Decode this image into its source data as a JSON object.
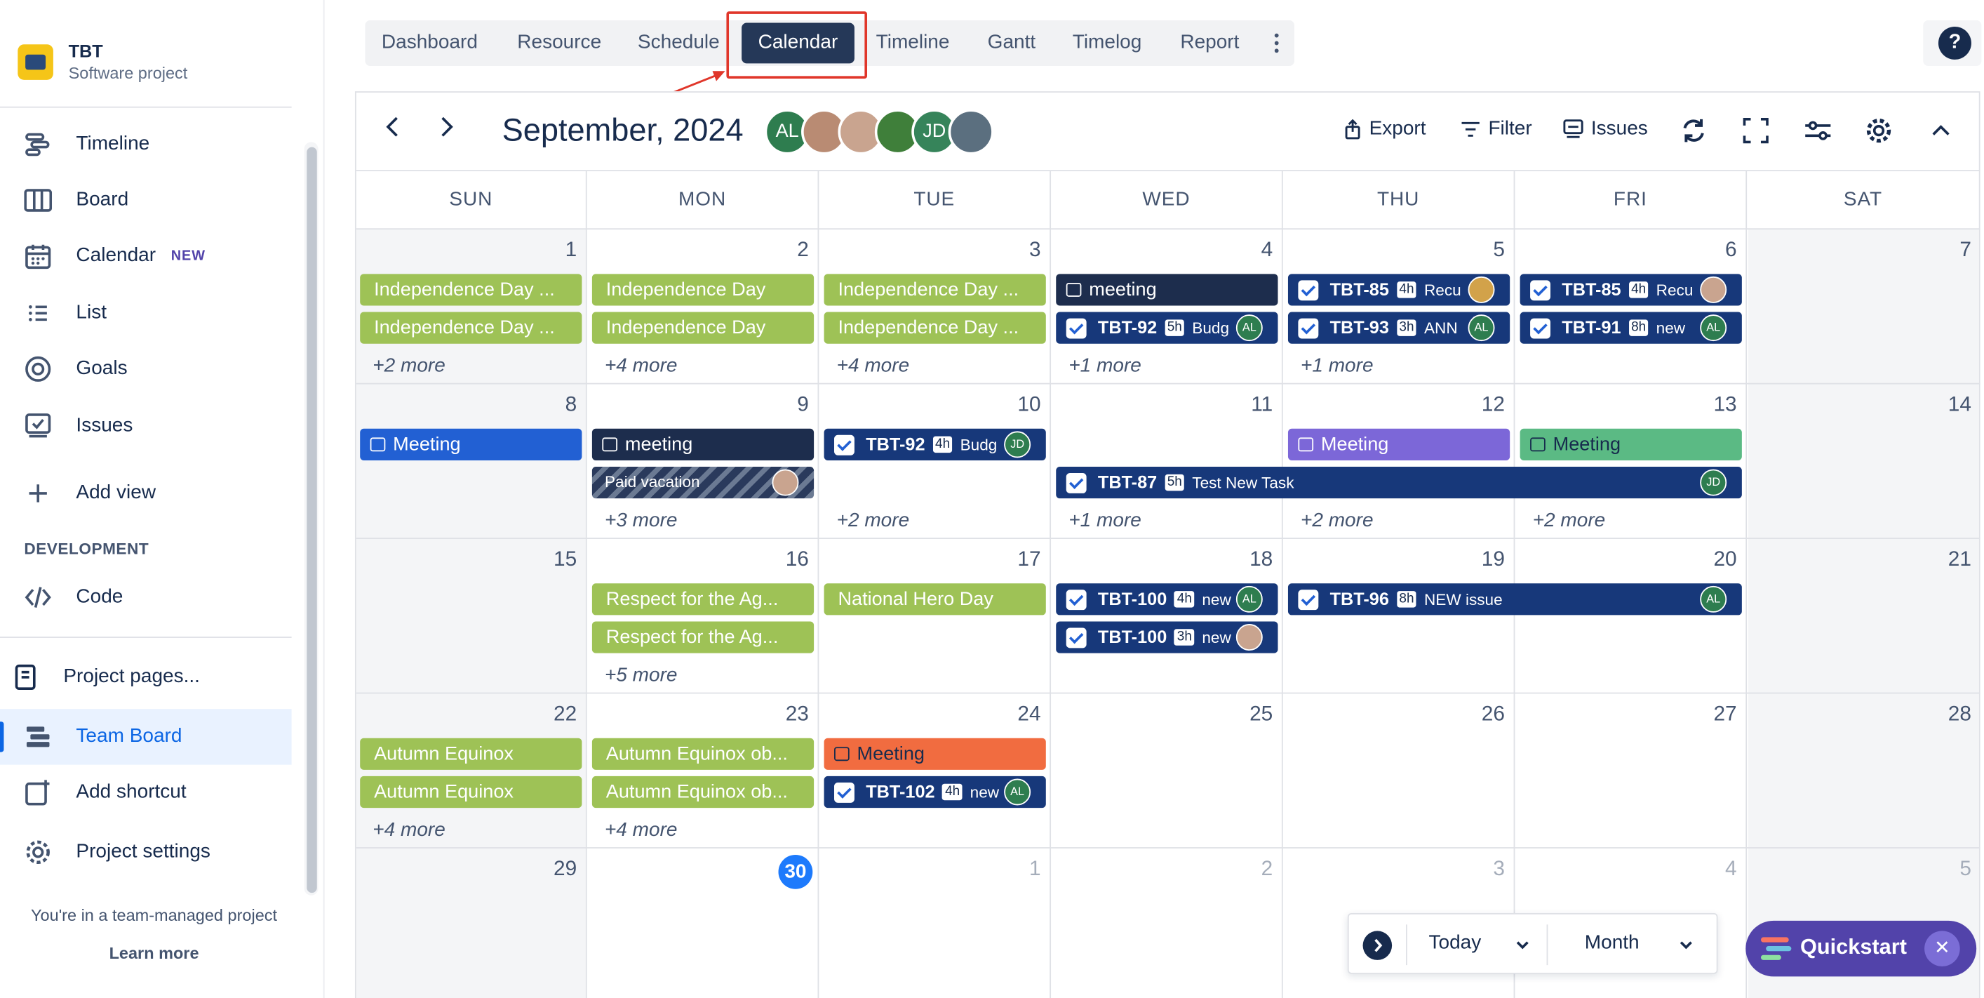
{
  "project": {
    "name": "TBT",
    "type": "Software project"
  },
  "sidebar": {
    "items": [
      {
        "label": "Timeline",
        "icon": "timeline-icon"
      },
      {
        "label": "Board",
        "icon": "board-icon"
      },
      {
        "label": "Calendar",
        "icon": "calendar-icon",
        "badge": "NEW"
      },
      {
        "label": "List",
        "icon": "list-icon"
      },
      {
        "label": "Goals",
        "icon": "goals-icon"
      },
      {
        "label": "Issues",
        "icon": "issues-icon"
      },
      {
        "label": "Add view",
        "icon": "plus-icon"
      }
    ],
    "dev_heading": "DEVELOPMENT",
    "code_label": "Code",
    "project_pages": "Project pages...",
    "team_board": "Team Board",
    "add_shortcut": "Add shortcut",
    "project_settings": "Project settings",
    "footer_text": "You're in a team-managed project",
    "learn_more": "Learn more"
  },
  "tabs": [
    "Dashboard",
    "Resource",
    "Schedule",
    "Calendar",
    "Timeline",
    "Gantt",
    "Timelog",
    "Report"
  ],
  "active_tab": "Calendar",
  "toolbar": {
    "month_title": "September, 2024",
    "export": "Export",
    "filter": "Filter",
    "issues": "Issues",
    "avatars": [
      "AL",
      "",
      "",
      "",
      "JD",
      ""
    ]
  },
  "weekdays": [
    "SUN",
    "MON",
    "TUE",
    "WED",
    "THU",
    "FRI",
    "SAT"
  ],
  "weeks": [
    [
      "1",
      "2",
      "3",
      "4",
      "5",
      "6",
      "7"
    ],
    [
      "8",
      "9",
      "10",
      "11",
      "12",
      "13",
      "14"
    ],
    [
      "15",
      "16",
      "17",
      "18",
      "19",
      "20",
      "21"
    ],
    [
      "22",
      "23",
      "24",
      "25",
      "26",
      "27",
      "28"
    ],
    [
      "29",
      "30",
      "1",
      "2",
      "3",
      "4",
      "5"
    ]
  ],
  "events": {
    "w1": {
      "sun": [
        "Independence Day ...",
        "Independence Day ..."
      ],
      "mon": [
        "Independence Day",
        "Independence Day"
      ],
      "tue": [
        "Independence Day ...",
        "Independence Day ..."
      ],
      "wed_meeting": "meeting",
      "wed_task": {
        "key": "TBT-92",
        "hours": "5h",
        "desc": "Budg",
        "avatar": "AL"
      },
      "thu_task1": {
        "key": "TBT-85",
        "hours": "4h",
        "desc": "Recu"
      },
      "thu_task2": {
        "key": "TBT-93",
        "hours": "3h",
        "desc": "ANN",
        "avatar": "AL"
      },
      "fri_task1": {
        "key": "TBT-85",
        "hours": "4h",
        "desc": "Recu"
      },
      "fri_task2": {
        "key": "TBT-91",
        "hours": "8h",
        "desc": "new",
        "avatar": "AL"
      },
      "more": [
        "+2 more",
        "+4 more",
        "+4 more",
        "+1 more",
        "+1 more"
      ]
    },
    "w2": {
      "sun": "Meeting",
      "mon_meeting": "meeting",
      "mon_vacation": "Paid vacation",
      "tue_task": {
        "key": "TBT-92",
        "hours": "4h",
        "desc": "Budg",
        "avatar": "JD"
      },
      "wed_fri_task": {
        "key": "TBT-87",
        "hours": "5h",
        "desc": "Test New Task",
        "avatar": "JD"
      },
      "thu": "Meeting",
      "fri": "Meeting",
      "more": [
        "+3 more",
        "+2 more",
        "+1 more",
        "+2 more",
        "+2 more"
      ]
    },
    "w3": {
      "mon": [
        "Respect for the Ag...",
        "Respect for the Ag..."
      ],
      "tue": "National Hero Day",
      "wed_task1": {
        "key": "TBT-100",
        "hours": "4h",
        "desc": "new",
        "avatar": "AL"
      },
      "wed_task2": {
        "key": "TBT-100",
        "hours": "3h",
        "desc": "new"
      },
      "thu_fri_task": {
        "key": "TBT-96",
        "hours": "8h",
        "desc": "NEW issue",
        "avatar": "AL"
      },
      "more": [
        "+5 more"
      ]
    },
    "w4": {
      "sun": [
        "Autumn Equinox",
        "Autumn Equinox"
      ],
      "mon": [
        "Autumn Equinox ob...",
        "Autumn Equinox ob..."
      ],
      "tue_meeting": "Meeting",
      "tue_task": {
        "key": "TBT-102",
        "hours": "4h",
        "desc": "new",
        "avatar": "AL"
      },
      "more": [
        "+4 more",
        "+4 more"
      ]
    }
  },
  "bottom": {
    "today": "Today",
    "view": "Month"
  },
  "quickstart": "Quickstart",
  "colors": {
    "accent": "#253858",
    "holiday": "#9ec256",
    "task": "#17387a",
    "highlight": "#e0362a"
  }
}
